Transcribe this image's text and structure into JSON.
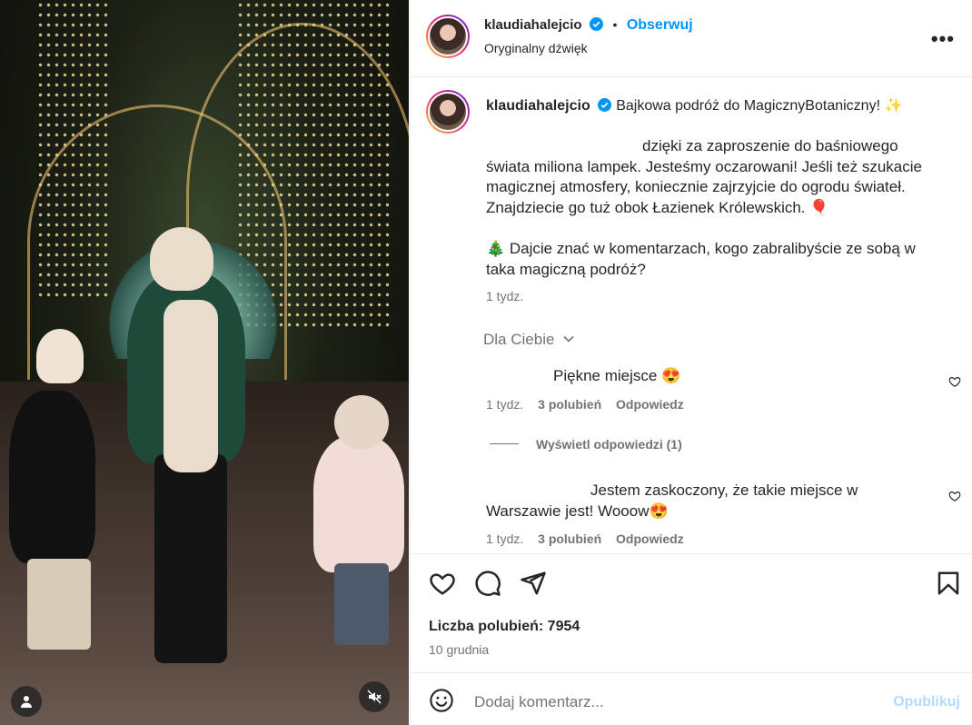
{
  "post": {
    "username": "klaudiahalejcio",
    "follow_label": "Obserwuj",
    "audio": "Oryginalny dźwięk",
    "caption_title": "Bajkowa podróż do MagicznyBotaniczny! ✨",
    "caption_body": "dzięki za zaproszenie do baśniowego świata miliona lampek. Jesteśmy oczarowani! Jeśli też szukacie magicznej atmosfery, koniecznie zajrzyjcie do ogrodu świateł. Znajdziecie go tuż obok Łazienek Królewskich. 🎈",
    "caption_body_lines": [
      "dzięki za zaproszenie do baśniowego",
      "świata miliona lampek. Jesteśmy oczarowani! Jeśli też szukacie",
      "magicznej atmosfery, koniecznie zajrzyjcie do ogrodu świateł.",
      "Znajdziecie go tuż obok Łazienek Królewskich. 🎈"
    ],
    "caption_footer_lines": [
      "🎄 Dajcie znać w komentarzach, kogo zabralibyście ze sobą w",
      "taka magiczną podróż?"
    ],
    "caption_time": "1 tydz.",
    "sort_label": "Dla Ciebie",
    "likes_label": "Liczba polubień: 7954",
    "date": "10 grudnia",
    "comment_placeholder": "Dodaj komentarz...",
    "publish_label": "Opublikuj"
  },
  "comments": [
    {
      "lines": [
        "Piękne miejsce 😍"
      ],
      "time": "1 tydz.",
      "likes": "3 polubień",
      "reply": "Odpowiedz",
      "view_replies": "Wyświetl odpowiedzi (1)"
    },
    {
      "lines": [
        "Jestem zaskoczony, że takie miejsce w",
        "Warszawie jest! Wooow😍"
      ],
      "time": "1 tydz.",
      "likes": "3 polubień",
      "reply": "Odpowiedz"
    }
  ],
  "icons": {
    "verified": "verified-badge-icon",
    "more": "more-options-icon",
    "chevron": "chevron-down-icon",
    "like": "heart-icon",
    "comment": "comment-icon",
    "share": "share-icon",
    "save": "bookmark-icon",
    "emoji": "emoji-icon",
    "mute": "mute-icon",
    "tags": "user-tag-icon"
  },
  "colors": {
    "accent": "#0095f6",
    "publish_disabled": "#b3dbff",
    "meta": "#737373"
  }
}
